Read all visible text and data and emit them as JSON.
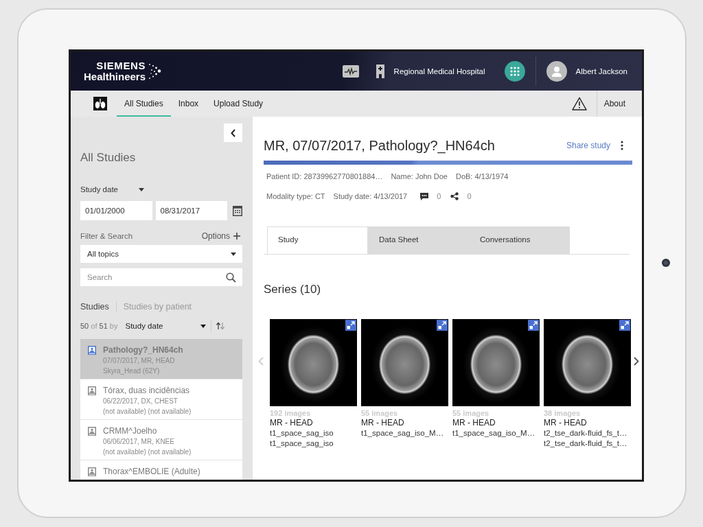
{
  "header": {
    "logo": {
      "line_1": "SIEMENS",
      "line_2": "Healthineers"
    },
    "hospital": "Regional Medical Hospital",
    "user": "Albert Jackson"
  },
  "nav": {
    "tabs": [
      {
        "label": "All Studies",
        "selected": true
      },
      {
        "label": "Inbox",
        "selected": false
      },
      {
        "label": "Upload Study",
        "selected": false
      }
    ],
    "about": "About"
  },
  "sidebar": {
    "title": "All Studies",
    "date_filter": {
      "label": "Study date",
      "from": "01/01/2000",
      "to": "08/31/2017"
    },
    "filter": {
      "label": "Filter & Search",
      "options": "Options",
      "topic": "All topics",
      "search_placeholder": "Search"
    },
    "view_tabs": [
      {
        "label": "Studies",
        "selected": true
      },
      {
        "label": "Studies by patient",
        "selected": false
      }
    ],
    "count": "**50** of **51** by",
    "sort": "Study date",
    "studies": [
      {
        "title": "Pathology?_HN64ch",
        "details": [
          "07/07/2017, MR, HEAD",
          "Skyra_Head (62Y)"
        ],
        "selected": true
      },
      {
        "title": "Tórax, duas incidências",
        "details": [
          "06/22/2017, DX, CHEST",
          "(not available) (not available)"
        ],
        "selected": false
      },
      {
        "title": "CRMM^Joelho",
        "details": [
          "06/06/2017, MR, KNEE",
          "(not available) (not available)"
        ],
        "selected": false
      },
      {
        "title": "Thorax^EMBOLIE (Adulte)",
        "selected": false
      }
    ]
  },
  "study": {
    "title": "MR, 07/07/2017, Pathology?_HN64ch",
    "share": "Share study",
    "info_1": [
      "Patient ID: 28739962770801884…",
      "Name: John Doe",
      "DoB: 4/13/1974"
    ],
    "info_2": [
      "Modality type: CT",
      "Study date: 4/13/2017"
    ],
    "comments": "0",
    "shares": "0",
    "tabs": [
      {
        "label": "Study",
        "selected": true
      },
      {
        "label": "Data Sheet",
        "selected": false
      },
      {
        "label": "Conversations",
        "selected": false
      }
    ],
    "series": {
      "title": "Series (10)",
      "previous": {
        "disabled": true
      },
      "next": {
        "disabled": false
      },
      "items": [
        {
          "count": "192 images",
          "modality": "MR - HEAD",
          "lines": [
            "t1_space_sag_iso",
            "t1_space_sag_iso"
          ]
        },
        {
          "count": "55 images",
          "modality": "MR - HEAD",
          "lines": [
            "t1_space_sag_iso_M…"
          ]
        },
        {
          "count": "55 images",
          "modality": "MR - HEAD",
          "lines": [
            "t1_space_sag_iso_M…"
          ]
        },
        {
          "count": "38 images",
          "modality": "MR - HEAD",
          "lines": [
            "t2_tse_dark-fluid_fs_t…",
            "t2_tse_dark-fluid_fs_t…"
          ]
        }
      ]
    }
  }
}
